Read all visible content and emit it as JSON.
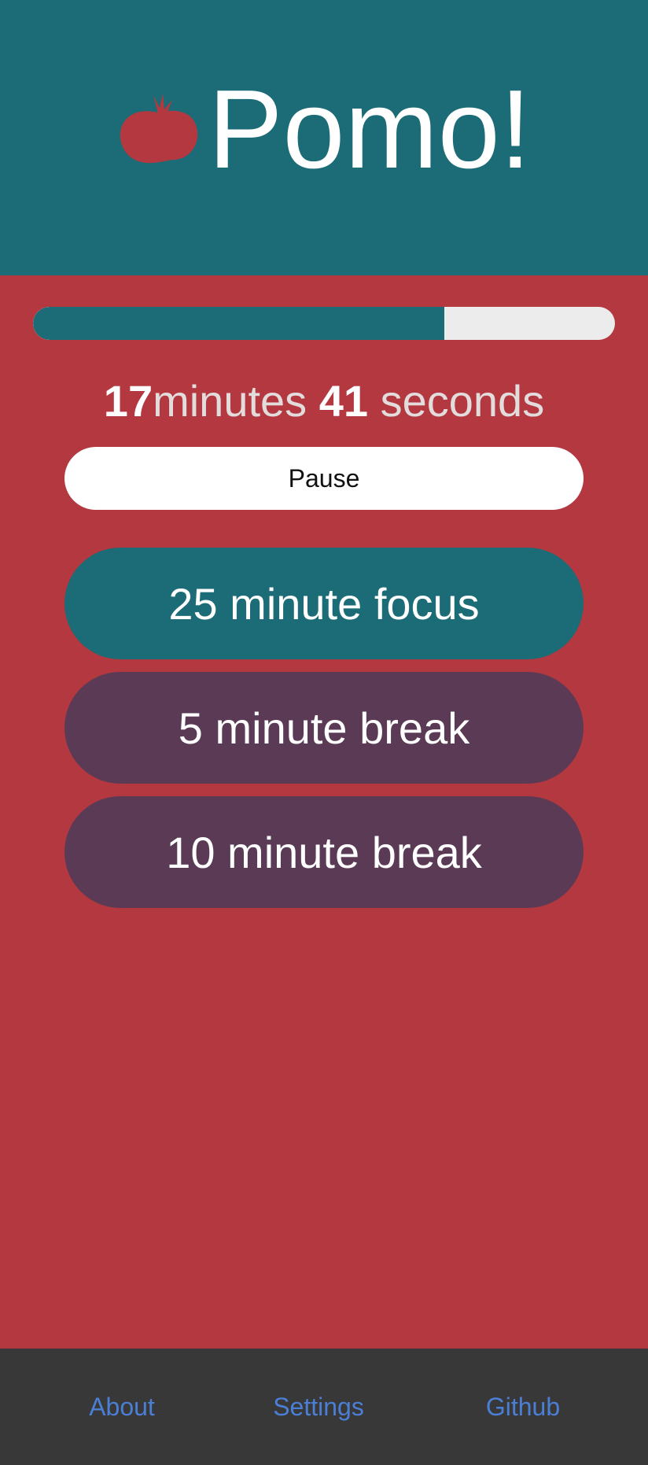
{
  "header": {
    "title": "Pomo!",
    "logo_icon": "tomato-icon",
    "background_color": "#1b6c76",
    "logo_color": "#b33840"
  },
  "progress": {
    "percent": 70.7
  },
  "timer": {
    "minutes": "17",
    "minutes_label": "minutes",
    "seconds": "41",
    "seconds_label": "seconds"
  },
  "controls": {
    "pause_label": "Pause"
  },
  "modes": [
    {
      "label": "25 minute focus",
      "color": "#1b6c76"
    },
    {
      "label": "5 minute break",
      "color": "#5b3a55"
    },
    {
      "label": "10 minute break",
      "color": "#5b3a55"
    }
  ],
  "footer": {
    "links": [
      {
        "label": "About"
      },
      {
        "label": "Settings"
      },
      {
        "label": "Github"
      }
    ],
    "link_color": "#4b7fd6",
    "background_color": "#383838"
  },
  "theme": {
    "background_color": "#b33840"
  }
}
